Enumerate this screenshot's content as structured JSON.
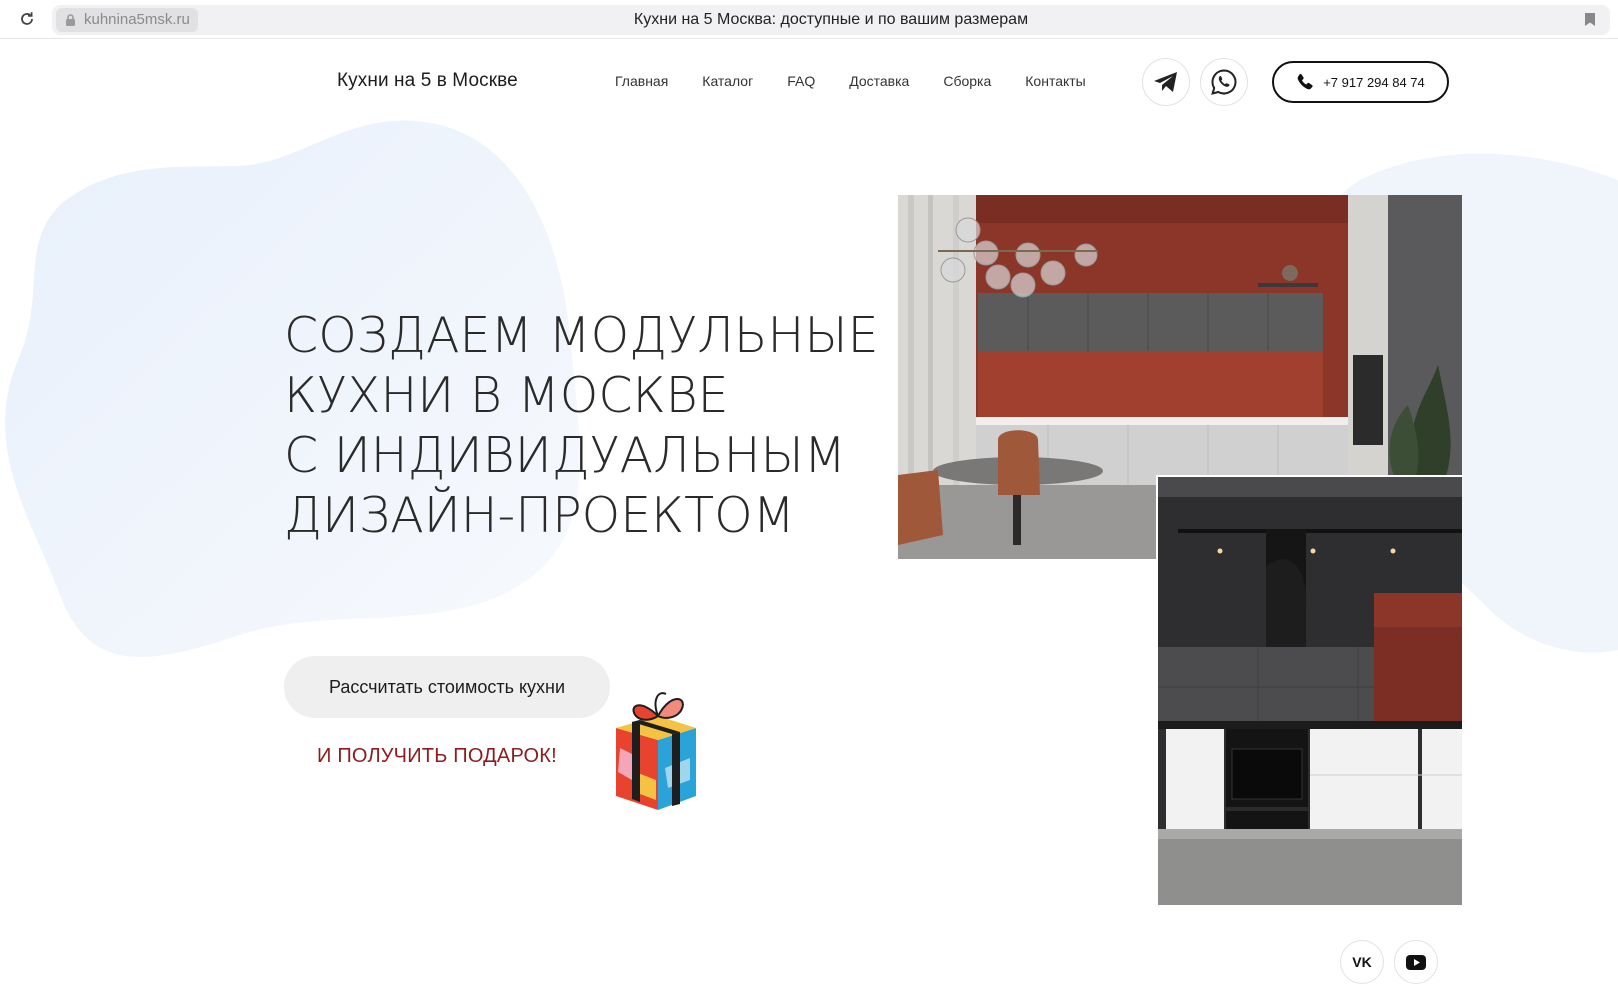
{
  "browser": {
    "url": "kuhnina5msk.ru",
    "tab_title": "Кухни на 5 Москва: доступные и по вашим размерам"
  },
  "header": {
    "logo": "Кухни на 5 в Москве",
    "nav": [
      "Главная",
      "Каталог",
      "FAQ",
      "Доставка",
      "Сборка",
      "Контакты"
    ],
    "phone": "+7 917 294 84 74"
  },
  "hero": {
    "title_lines": [
      "СОЗДАЕМ МОДУЛЬНЫЕ",
      "КУХНИ В МОСКВЕ",
      "С ИНДИВИДУАЛЬНЫМ",
      "ДИЗАЙН-ПРОЕКТОМ"
    ],
    "cta_label": "Рассчитать стоимость кухни",
    "gift_text": "И ПОЛУЧИТЬ ПОДАРОК!"
  },
  "footer_socials": {
    "vk_label": "VK"
  },
  "colors": {
    "accent_red": "#8e1c1c",
    "blob": "#eef4fc",
    "terracotta": "#8c3529",
    "dark": "#2b2b2d"
  }
}
